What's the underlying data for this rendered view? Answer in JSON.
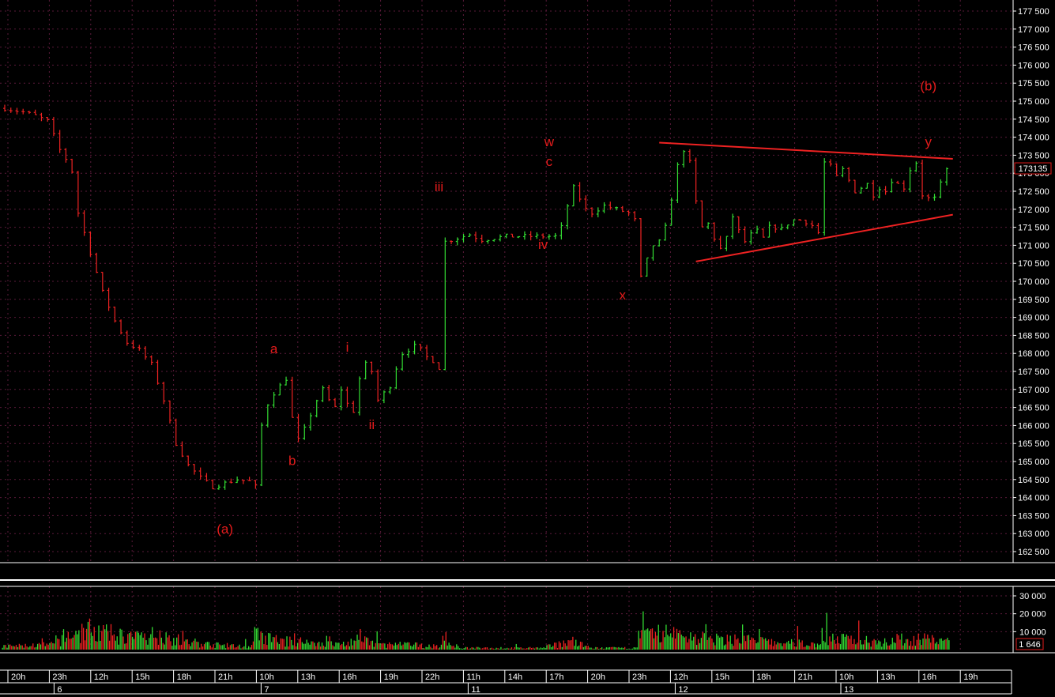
{
  "chart_data": {
    "type": "ohlc",
    "colors": {
      "background": "#000000",
      "up": "#33dd33",
      "down": "#ee2222",
      "annotation": "#e31b1b",
      "trendline": "#ee2222",
      "grid": "#5a1a3a",
      "axis_text": "#ffffff",
      "price_badge_border": "#e31b1b"
    },
    "price_axis": {
      "min": 162500,
      "max": 177500,
      "ticks": [
        "162 500",
        "163 000",
        "163 500",
        "164 000",
        "164 500",
        "165 000",
        "165 500",
        "166 000",
        "166 500",
        "167 000",
        "167 500",
        "168 000",
        "168 500",
        "169 000",
        "169 500",
        "170 000",
        "170 500",
        "171 000",
        "171 500",
        "172 000",
        "172 500",
        "173 000",
        "173 500",
        "174 000",
        "174 500",
        "175 000",
        "175 500",
        "176 000",
        "176 500",
        "177 000",
        "177 500"
      ],
      "last_price_label": "173135",
      "last_price_value": 173135
    },
    "volume_axis": {
      "max": 30000,
      "ticks": [
        "10 000",
        "20 000",
        "30 000"
      ],
      "last_volume_label": "1 646"
    },
    "time_axis": {
      "hour_labels": [
        "20h",
        "23h",
        "12h",
        "15h",
        "18h",
        "21h",
        "10h",
        "13h",
        "16h",
        "19h",
        "22h",
        "11h",
        "14h",
        "17h",
        "20h",
        "23h",
        "12h",
        "15h",
        "18h",
        "21h",
        "10h",
        "13h",
        "16h",
        "19h"
      ],
      "day_labels": [
        "6",
        "7",
        "11",
        "12",
        "13"
      ]
    },
    "price_path": [
      [
        0,
        174800
      ],
      [
        3,
        174700
      ],
      [
        5,
        174600
      ],
      [
        7,
        174450
      ],
      [
        8,
        174050
      ],
      [
        9,
        173650
      ],
      [
        10,
        173400
      ],
      [
        11,
        173050
      ],
      [
        12,
        171900
      ],
      [
        14,
        170800
      ],
      [
        16,
        169700
      ],
      [
        18,
        168900
      ],
      [
        20,
        168300
      ],
      [
        22,
        168100
      ],
      [
        24,
        167700
      ],
      [
        26,
        166700
      ],
      [
        28,
        165500
      ],
      [
        30,
        164900
      ],
      [
        32,
        164550
      ],
      [
        34,
        164300
      ],
      [
        36,
        164400
      ],
      [
        38,
        164500
      ],
      [
        40,
        164450
      ],
      [
        41,
        164300
      ],
      [
        42,
        166000
      ],
      [
        43,
        166600
      ],
      [
        44,
        166900
      ],
      [
        45,
        167100
      ],
      [
        46,
        167300
      ],
      [
        47,
        166200
      ],
      [
        48,
        165600
      ],
      [
        49,
        165900
      ],
      [
        50,
        166300
      ],
      [
        51,
        166700
      ],
      [
        52,
        167000
      ],
      [
        53,
        166700
      ],
      [
        54,
        166500
      ],
      [
        55,
        167000
      ],
      [
        56,
        166600
      ],
      [
        57,
        166400
      ],
      [
        58,
        167300
      ],
      [
        59,
        167700
      ],
      [
        60,
        167500
      ],
      [
        61,
        166700
      ],
      [
        62,
        166900
      ],
      [
        63,
        167100
      ],
      [
        64,
        167600
      ],
      [
        65,
        168000
      ],
      [
        66,
        168100
      ],
      [
        67,
        168200
      ],
      [
        68,
        168100
      ],
      [
        69,
        167900
      ],
      [
        70,
        167800
      ],
      [
        71,
        167600
      ],
      [
        72,
        171100
      ],
      [
        74,
        171200
      ],
      [
        76,
        171300
      ],
      [
        78,
        171150
      ],
      [
        80,
        171200
      ],
      [
        82,
        171250
      ],
      [
        84,
        171250
      ],
      [
        86,
        171250
      ],
      [
        88,
        171250
      ],
      [
        90,
        171250
      ],
      [
        91,
        171500
      ],
      [
        92,
        172100
      ],
      [
        93,
        172600
      ],
      [
        94,
        172300
      ],
      [
        95,
        172000
      ],
      [
        96,
        171900
      ],
      [
        98,
        172100
      ],
      [
        100,
        172000
      ],
      [
        102,
        171900
      ],
      [
        103,
        171700
      ],
      [
        104,
        170100
      ],
      [
        105,
        170600
      ],
      [
        106,
        171000
      ],
      [
        107,
        171100
      ],
      [
        108,
        171500
      ],
      [
        109,
        172300
      ],
      [
        110,
        173200
      ],
      [
        111,
        173650
      ],
      [
        112,
        173300
      ],
      [
        113,
        172200
      ],
      [
        114,
        171500
      ],
      [
        115,
        171600
      ],
      [
        116,
        171200
      ],
      [
        117,
        170900
      ],
      [
        118,
        171200
      ],
      [
        119,
        171800
      ],
      [
        120,
        171400
      ],
      [
        121,
        171100
      ],
      [
        122,
        171300
      ],
      [
        123,
        171400
      ],
      [
        124,
        171200
      ],
      [
        125,
        171500
      ],
      [
        126,
        171500
      ],
      [
        127,
        171450
      ],
      [
        128,
        171600
      ],
      [
        129,
        171700
      ],
      [
        130,
        171700
      ],
      [
        131,
        171650
      ],
      [
        132,
        171550
      ],
      [
        133,
        171350
      ],
      [
        134,
        173300
      ],
      [
        135,
        173200
      ],
      [
        136,
        172900
      ],
      [
        137,
        173100
      ],
      [
        138,
        172800
      ],
      [
        139,
        172500
      ],
      [
        140,
        172600
      ],
      [
        141,
        172700
      ],
      [
        142,
        172400
      ],
      [
        143,
        172600
      ],
      [
        144,
        172500
      ],
      [
        145,
        172800
      ],
      [
        146,
        172700
      ],
      [
        147,
        172600
      ],
      [
        148,
        173100
      ],
      [
        149,
        173300
      ],
      [
        150,
        172400
      ],
      [
        151,
        172300
      ],
      [
        152,
        172300
      ],
      [
        153,
        172700
      ],
      [
        154,
        173100
      ]
    ],
    "volume_profile": [
      [
        0,
        2
      ],
      [
        8,
        3
      ],
      [
        10,
        8
      ],
      [
        12,
        10
      ],
      [
        14,
        12
      ],
      [
        16,
        10
      ],
      [
        18,
        9
      ],
      [
        20,
        8
      ],
      [
        22,
        7
      ],
      [
        24,
        9
      ],
      [
        26,
        8
      ],
      [
        28,
        6
      ],
      [
        30,
        4
      ],
      [
        34,
        3
      ],
      [
        38,
        2
      ],
      [
        40,
        2
      ],
      [
        41,
        9
      ],
      [
        42,
        7
      ],
      [
        44,
        6
      ],
      [
        46,
        5
      ],
      [
        48,
        5
      ],
      [
        50,
        4
      ],
      [
        52,
        4
      ],
      [
        54,
        3
      ],
      [
        56,
        4
      ],
      [
        58,
        6
      ],
      [
        60,
        4
      ],
      [
        62,
        3
      ],
      [
        66,
        3
      ],
      [
        70,
        2
      ],
      [
        71,
        2
      ],
      [
        72,
        7
      ],
      [
        73,
        3
      ],
      [
        75,
        1
      ],
      [
        80,
        1
      ],
      [
        88,
        1
      ],
      [
        89,
        2
      ],
      [
        90,
        3
      ],
      [
        92,
        5
      ],
      [
        94,
        3
      ],
      [
        96,
        1
      ],
      [
        103,
        1
      ],
      [
        104,
        8
      ],
      [
        106,
        9
      ],
      [
        108,
        10
      ],
      [
        110,
        9
      ],
      [
        112,
        8
      ],
      [
        114,
        7
      ],
      [
        116,
        6
      ],
      [
        118,
        6
      ],
      [
        120,
        7
      ],
      [
        122,
        6
      ],
      [
        124,
        5
      ],
      [
        126,
        4
      ],
      [
        128,
        4
      ],
      [
        130,
        4
      ],
      [
        133,
        3
      ],
      [
        134,
        9
      ],
      [
        135,
        7
      ],
      [
        137,
        6
      ],
      [
        140,
        6
      ],
      [
        143,
        5
      ],
      [
        146,
        6
      ],
      [
        149,
        6
      ],
      [
        152,
        6
      ],
      [
        154,
        5
      ]
    ],
    "annotations": [
      {
        "label": "(a)",
        "bar": 36,
        "price": 163000
      },
      {
        "label": "a",
        "bar": 44,
        "price": 168000
      },
      {
        "label": "b",
        "bar": 47,
        "price": 164900
      },
      {
        "label": "i",
        "bar": 56,
        "price": 168050
      },
      {
        "label": "ii",
        "bar": 60,
        "price": 165900
      },
      {
        "label": "iii",
        "bar": 71,
        "price": 172500
      },
      {
        "label": "iv",
        "bar": 88,
        "price": 170900
      },
      {
        "label": "w",
        "bar": 89,
        "price": 173750
      },
      {
        "label": "c",
        "bar": 89,
        "price": 173200
      },
      {
        "label": "x",
        "bar": 101,
        "price": 169500
      },
      {
        "label": "(b)",
        "bar": 151,
        "price": 175300
      },
      {
        "label": "y",
        "bar": 151,
        "price": 173750
      }
    ],
    "trendlines": [
      {
        "from": [
          107,
          173850
        ],
        "to": [
          155,
          173400
        ]
      },
      {
        "from": [
          113,
          170550
        ],
        "to": [
          155,
          171850
        ]
      }
    ]
  }
}
